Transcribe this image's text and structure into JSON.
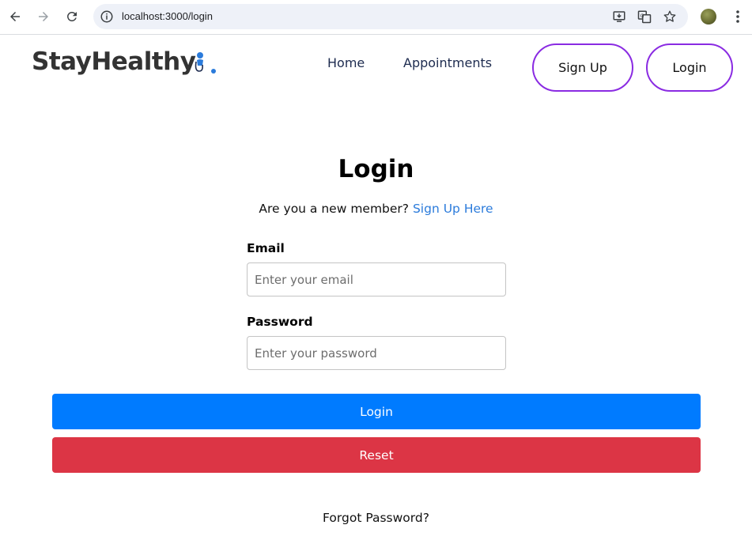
{
  "browser": {
    "url": "localhost:3000/login",
    "icons": [
      "back-icon",
      "forward-icon",
      "reload-icon",
      "info-icon",
      "install-app-icon",
      "translate-icon",
      "bookmark-star-icon",
      "profile-avatar",
      "menu-kebab-icon"
    ]
  },
  "header": {
    "logo_text": "StayHealthy",
    "logo_icon": "doctor-person-icon",
    "nav": {
      "home": "Home",
      "appointments": "Appointments"
    },
    "signup_button": "Sign Up",
    "login_button": "Login",
    "accent_color": "#8a2be2"
  },
  "form": {
    "title": "Login",
    "subtitle_prefix": "Are you a new member?",
    "signup_link": "Sign Up Here",
    "email_label": "Email",
    "email_placeholder": "Enter your email",
    "email_value": "",
    "password_label": "Password",
    "password_placeholder": "Enter your password",
    "password_value": "",
    "login_button": "Login",
    "reset_button": "Reset",
    "forgot_password": "Forgot Password?",
    "colors": {
      "login_button": "#007bff",
      "reset_button": "#dc3545",
      "link": "#2b7bdb"
    }
  }
}
